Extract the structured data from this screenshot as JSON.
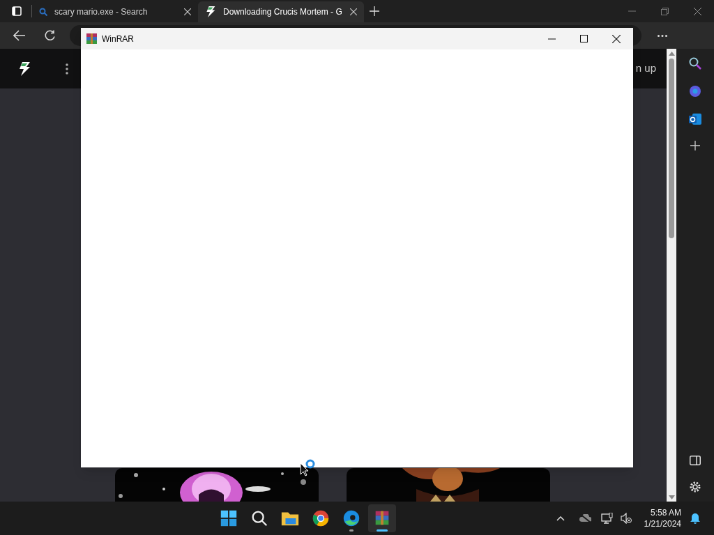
{
  "browser": {
    "tabs": [
      {
        "kind": "search",
        "title": "scary mario.exe - Search",
        "selected": false
      },
      {
        "kind": "bolt",
        "title": "Downloading Crucis Mortem - G",
        "selected": true
      }
    ],
    "page": {
      "header_text": "n up"
    }
  },
  "dialog": {
    "title": "WinRAR"
  },
  "taskbar": {
    "apps": [
      {
        "kind": "start",
        "running": false,
        "active": false
      },
      {
        "kind": "search",
        "running": false,
        "active": false
      },
      {
        "kind": "folder",
        "running": false,
        "active": false
      },
      {
        "kind": "chrome",
        "running": false,
        "active": false
      },
      {
        "kind": "edge",
        "running": true,
        "active": false
      },
      {
        "kind": "winrar",
        "running": true,
        "active": true
      }
    ],
    "time": "5:58 AM",
    "date": "1/21/2024"
  }
}
